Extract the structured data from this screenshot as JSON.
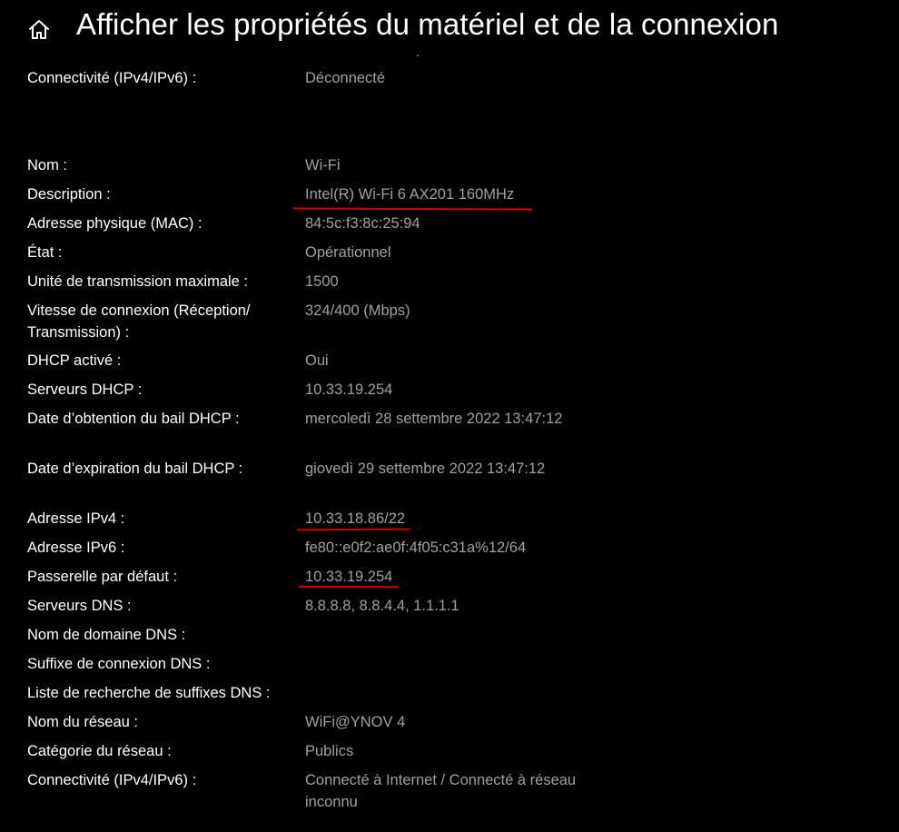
{
  "header": {
    "title": "Afficher les propriétés du matériel et de la connexion",
    "home_icon": "home-icon"
  },
  "colors": {
    "background": "#000000",
    "label_text": "#ffffff",
    "value_text": "#a0a0a0",
    "annotation": "#d40000"
  },
  "rows": [
    {
      "label": "Connectivité (IPv4/IPv6) :",
      "value": "Déconnecté"
    },
    {
      "label": "Nom :",
      "value": "Wi-Fi"
    },
    {
      "label": "Description :",
      "value": "Intel(R) Wi-Fi 6 AX201 160MHz"
    },
    {
      "label": "Adresse physique (MAC) :",
      "value": "84:5c:f3:8c:25:94"
    },
    {
      "label": "État :",
      "value": "Opérationnel"
    },
    {
      "label": "Unité de transmission maximale :",
      "value": "1500"
    },
    {
      "label": "Vitesse de connexion (Réception/ Transmission) :",
      "value": "324/400 (Mbps)"
    },
    {
      "label": "DHCP activé :",
      "value": "Oui"
    },
    {
      "label": "Serveurs DHCP :",
      "value": "10.33.19.254"
    },
    {
      "label": "Date d’obtention du bail DHCP :",
      "value": "mercoledì 28 settembre 2022 13:47:12"
    },
    {
      "label": "Date d’expiration du bail DHCP :",
      "value": "giovedì 29 settembre 2022 13:47:12"
    },
    {
      "label": "Adresse IPv4 :",
      "value": "10.33.18.86/22"
    },
    {
      "label": "Adresse IPv6 :",
      "value": "fe80::e0f2:ae0f:4f05:c31a%12/64"
    },
    {
      "label": "Passerelle par défaut :",
      "value": "10.33.19.254"
    },
    {
      "label": "Serveurs DNS :",
      "value": "8.8.8.8, 8.8.4.4, 1.1.1.1"
    },
    {
      "label": "Nom de domaine DNS :",
      "value": ""
    },
    {
      "label": "Suffixe de connexion DNS :",
      "value": ""
    },
    {
      "label": "Liste de recherche de suffixes DNS :",
      "value": ""
    },
    {
      "label": "Nom du réseau :",
      "value": "WiFi@YNOV 4"
    },
    {
      "label": "Catégorie du réseau :",
      "value": "Publics"
    },
    {
      "label": "Connectivité (IPv4/IPv6) :",
      "value": "Connecté à Internet / Connecté à réseau inconnu"
    }
  ]
}
